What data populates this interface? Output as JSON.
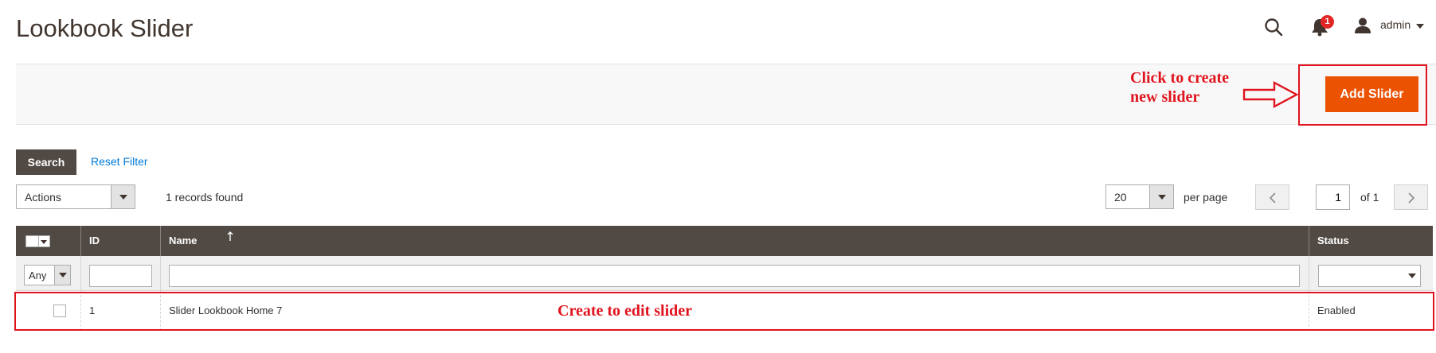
{
  "page": {
    "title": "Lookbook Slider"
  },
  "header": {
    "notification_count": "1",
    "user": "admin"
  },
  "page_actions": {
    "add_button": "Add Slider"
  },
  "annotations": {
    "create_hint": "Click to create\nnew slider",
    "edit_hint": "Create to edit slider",
    "color": "#e0141e"
  },
  "toolbar": {
    "search_button": "Search",
    "reset_filter": "Reset Filter",
    "actions_label": "Actions",
    "records_found": "1 records found",
    "per_page_value": "20",
    "per_page_label": "per page",
    "current_page": "1",
    "page_of": "of 1"
  },
  "grid": {
    "columns": [
      "ID",
      "Name",
      "Status"
    ],
    "filters": {
      "visibility": "Any"
    },
    "rows": [
      {
        "id": "1",
        "name": "Slider Lookbook Home 7",
        "status": "Enabled"
      }
    ]
  },
  "colors": {
    "primary_button": "#eb5202",
    "header_bg": "#514943",
    "link": "#007bdb"
  }
}
